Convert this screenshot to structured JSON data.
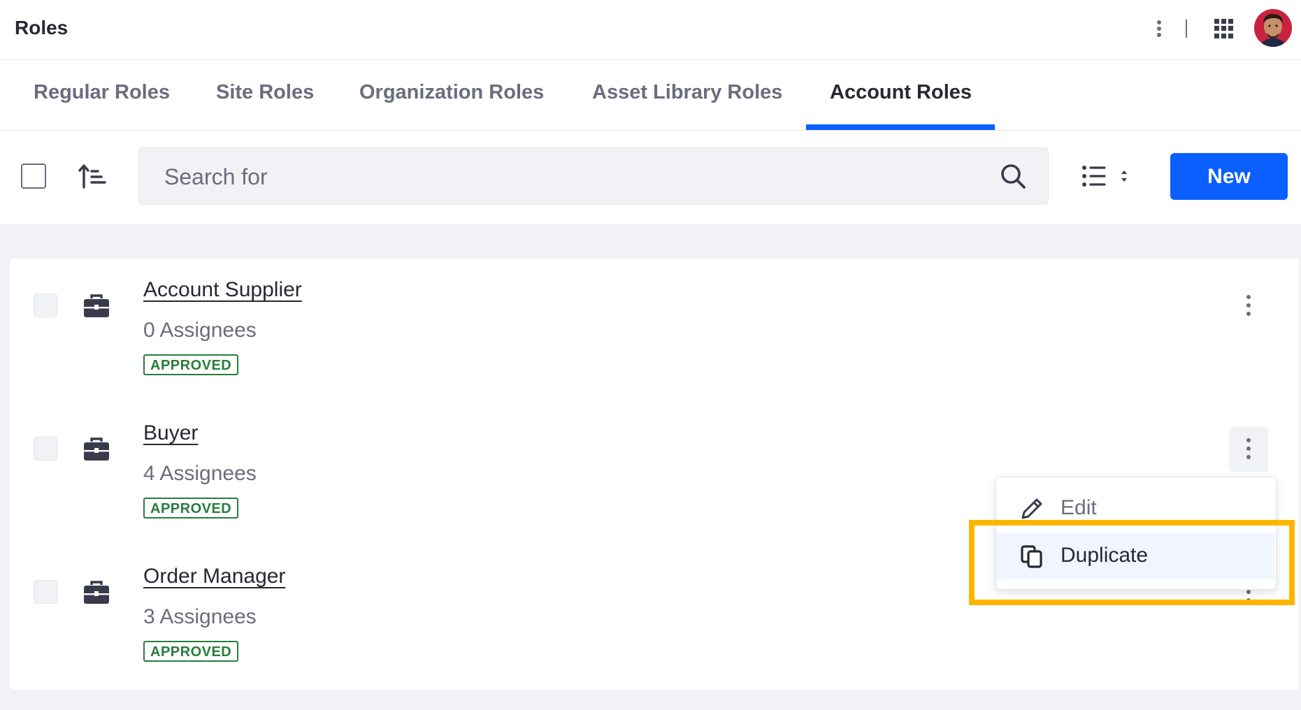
{
  "header": {
    "title": "Roles"
  },
  "tabs": [
    {
      "label": "Regular Roles"
    },
    {
      "label": "Site Roles"
    },
    {
      "label": "Organization Roles"
    },
    {
      "label": "Asset Library Roles"
    },
    {
      "label": "Account Roles",
      "active": true
    }
  ],
  "toolbar": {
    "search_placeholder": "Search for",
    "new_label": "New"
  },
  "roles": [
    {
      "name": "Account Supplier",
      "assignees": "0 Assignees",
      "status": "APPROVED"
    },
    {
      "name": "Buyer",
      "assignees": "4 Assignees",
      "status": "APPROVED"
    },
    {
      "name": "Order Manager",
      "assignees": "3 Assignees",
      "status": "APPROVED"
    }
  ],
  "dropdown": {
    "items": [
      {
        "label": "Edit",
        "icon": "pencil-icon"
      },
      {
        "label": "Duplicate",
        "icon": "copy-icon",
        "highlighted": true
      }
    ]
  },
  "colors": {
    "accent": "#0b5fff",
    "approved": "#287d3c",
    "highlight": "#ffb500"
  }
}
